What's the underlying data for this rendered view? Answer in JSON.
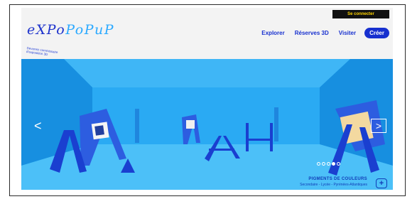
{
  "header": {
    "login_label": "Se connecter",
    "logo_text_dark": "eXPo",
    "logo_text_light": "PoPuP",
    "logo_tagline": "Devenez commissaire d'exposition 3D"
  },
  "nav": {
    "items": [
      "Explorer",
      "Réserves 3D",
      "Visiter"
    ],
    "create_label": "Créer"
  },
  "carousel": {
    "prev_glyph": "<",
    "next_glyph": ">",
    "slide_count": 5,
    "active_index": 3,
    "caption_title": "PIGMENTS DE COULEURS",
    "caption_subtitle": "Secondaire - Lycée - Pyrénées-Atlantiques",
    "plus_glyph": "+"
  },
  "colors": {
    "brand_blue": "#1730cf",
    "hero_blue": "#1ea3f0",
    "login_bg": "#111111",
    "login_text": "#ffd400"
  }
}
